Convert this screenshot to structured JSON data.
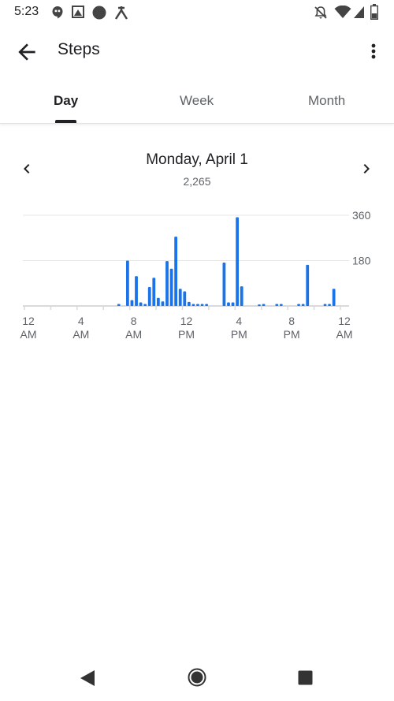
{
  "status_bar": {
    "time": "5:23",
    "icons": [
      "hangouts-icon",
      "photo-icon",
      "circle-icon",
      "tools-icon",
      "notifications-off-icon",
      "wifi-icon",
      "signal-icon",
      "battery-icon"
    ]
  },
  "app_bar": {
    "title": "Steps",
    "back_icon": "arrow-back-icon",
    "menu_icon": "more-vert-icon"
  },
  "tabs": [
    {
      "label": "Day",
      "active": true
    },
    {
      "label": "Week",
      "active": false
    },
    {
      "label": "Month",
      "active": false
    }
  ],
  "date_nav": {
    "title": "Monday, April 1",
    "total": "2,265"
  },
  "chart_data": {
    "type": "bar",
    "title": "",
    "xlabel": "",
    "ylabel": "",
    "ylim": [
      0,
      360
    ],
    "y_ticks": [
      "360",
      "180"
    ],
    "x_ticks": [
      {
        "line1": "12",
        "line2": "AM"
      },
      {
        "line1": "4",
        "line2": "AM"
      },
      {
        "line1": "8",
        "line2": "AM"
      },
      {
        "line1": "12",
        "line2": "PM"
      },
      {
        "line1": "4",
        "line2": "PM"
      },
      {
        "line1": "8",
        "line2": "PM"
      },
      {
        "line1": "12",
        "line2": "AM"
      }
    ],
    "bar_color": "#1a73e8",
    "intervals": 72,
    "x": [
      21,
      23,
      24,
      25,
      26,
      27,
      28,
      29,
      30,
      31,
      32,
      33,
      34,
      35,
      36,
      37,
      38,
      39,
      40,
      41,
      45,
      46,
      47,
      48,
      49,
      53,
      54,
      57,
      58,
      62,
      63,
      64,
      68,
      69,
      70
    ],
    "values": [
      8,
      180,
      23,
      118,
      14,
      8,
      75,
      112,
      32,
      18,
      178,
      148,
      275,
      68,
      58,
      16,
      8,
      8,
      8,
      8,
      172,
      14,
      14,
      352,
      78,
      6,
      8,
      8,
      8,
      8,
      8,
      163,
      8,
      8,
      68
    ]
  },
  "nav_bar": {
    "back": "nav-back-icon",
    "home": "nav-home-icon",
    "recents": "nav-recents-icon"
  }
}
